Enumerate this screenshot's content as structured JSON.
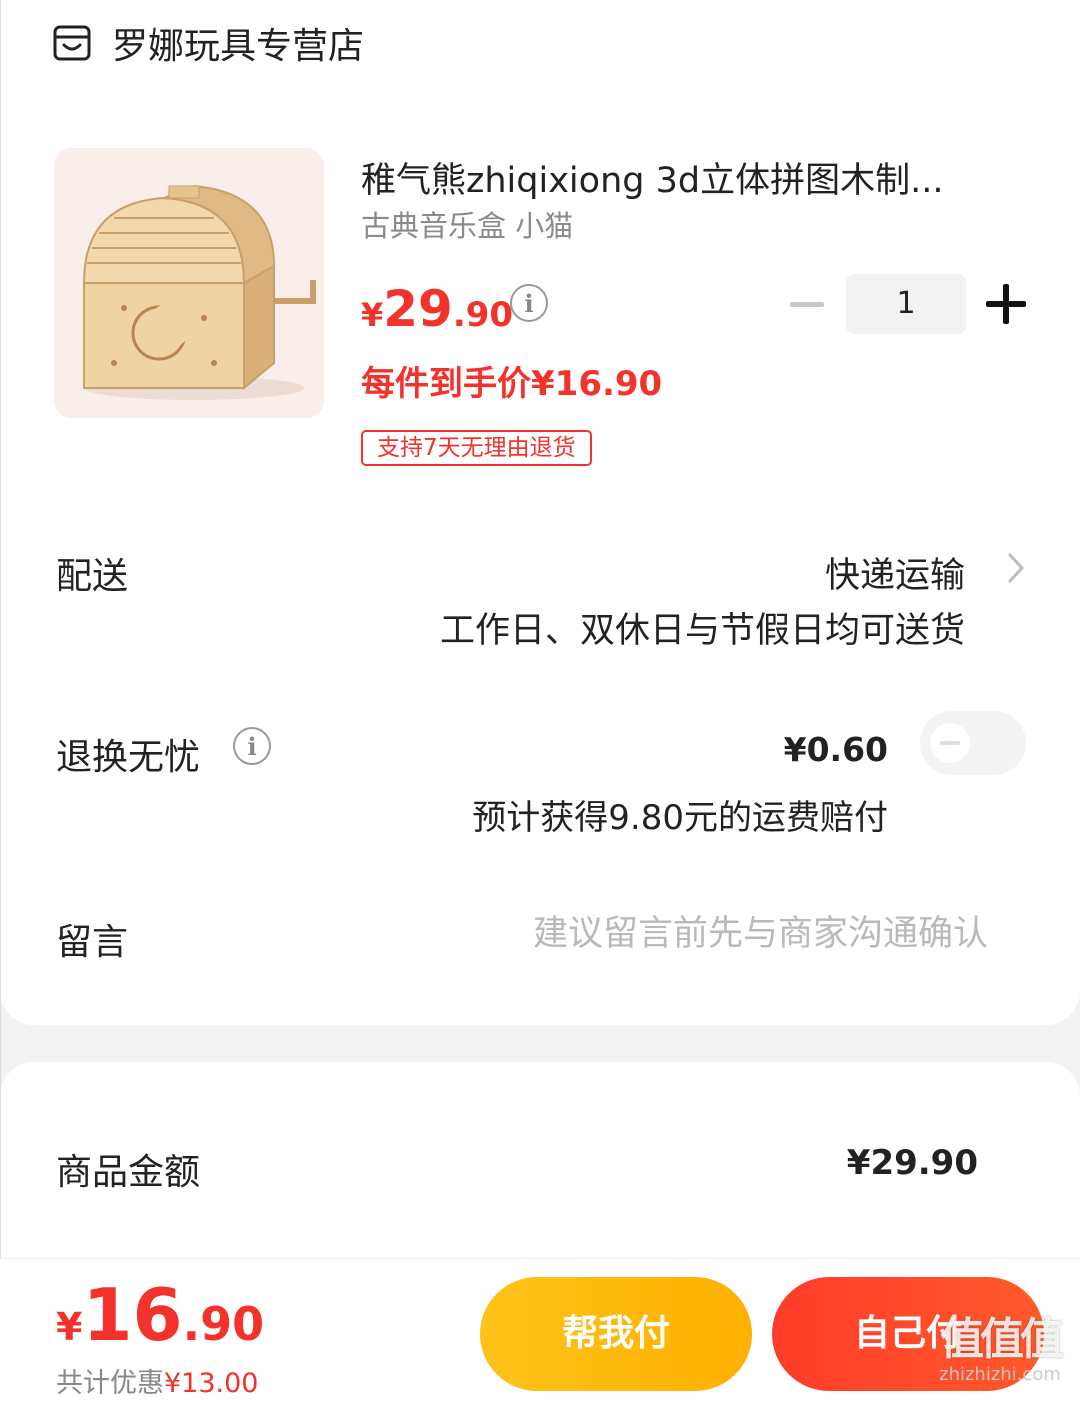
{
  "store": {
    "name": "罗娜玩具专营店",
    "icon": "store-icon"
  },
  "product": {
    "title": "稚气熊zhiqixiong  3d立体拼图木制...",
    "spec": "古典音乐盒 小猫",
    "price_currency": "¥",
    "price_int": "29",
    "price_dec": ".90",
    "final_price": "每件到手价¥16.90",
    "return_tag": "支持7天无理由退货",
    "quantity": "1"
  },
  "delivery": {
    "label": "配送",
    "method": "快递运输",
    "note": "工作日、双休日与节假日均可送货"
  },
  "return_service": {
    "label": "退换无忧",
    "price": "¥0.60",
    "note": "预计获得9.80元的运费赔付",
    "enabled": false
  },
  "message": {
    "label": "留言",
    "placeholder": "建议留言前先与商家沟通确认"
  },
  "summary": {
    "goods_label": "商品金额",
    "goods_amount": "¥29.90"
  },
  "footer": {
    "total_currency": "¥",
    "total_int": "16",
    "total_dec": ".90",
    "saving_label": "共计优惠",
    "saving_amount": "¥13.00",
    "help_pay_label": "帮我付",
    "self_pay_label": "自己付"
  },
  "watermark": {
    "glyph": "值值值",
    "text": "zhizhizhi.com"
  },
  "colors": {
    "accent": "#f2322b",
    "help_button": "#ffb800",
    "pay_button": "#ff3c2a"
  }
}
